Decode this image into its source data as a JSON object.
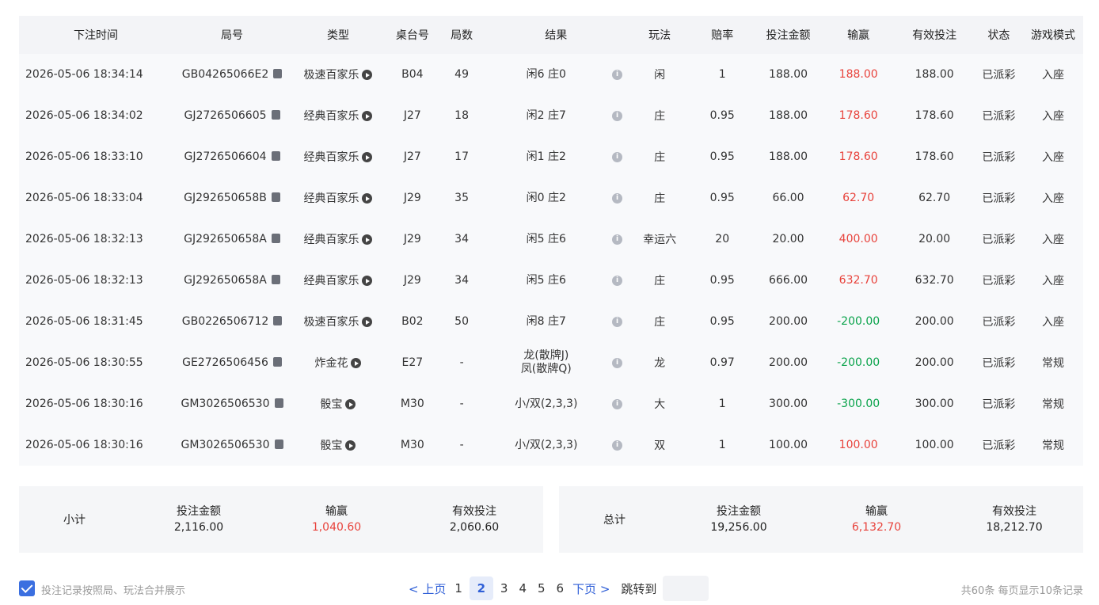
{
  "columns": [
    "下注时间",
    "局号",
    "类型",
    "桌台号",
    "局数",
    "结果",
    "玩法",
    "赔率",
    "投注金额",
    "输赢",
    "有效投注",
    "状态",
    "游戏模式"
  ],
  "rows": [
    {
      "time": "2026-05-06 18:34:14",
      "round": "GB04265066E2",
      "type": "极速百家乐",
      "table": "B04",
      "num": "49",
      "result": "闲6 庄0",
      "play": "闲",
      "odds": "1",
      "bet": "188.00",
      "win": "188.00",
      "win_color": "red",
      "valid": "188.00",
      "status": "已派彩",
      "mode": "入座"
    },
    {
      "time": "2026-05-06 18:34:02",
      "round": "GJ2726506605",
      "type": "经典百家乐",
      "table": "J27",
      "num": "18",
      "result": "闲2 庄7",
      "play": "庄",
      "odds": "0.95",
      "bet": "188.00",
      "win": "178.60",
      "win_color": "red",
      "valid": "178.60",
      "status": "已派彩",
      "mode": "入座"
    },
    {
      "time": "2026-05-06 18:33:10",
      "round": "GJ2726506604",
      "type": "经典百家乐",
      "table": "J27",
      "num": "17",
      "result": "闲1 庄2",
      "play": "庄",
      "odds": "0.95",
      "bet": "188.00",
      "win": "178.60",
      "win_color": "red",
      "valid": "178.60",
      "status": "已派彩",
      "mode": "入座"
    },
    {
      "time": "2026-05-06 18:33:04",
      "round": "GJ292650658B",
      "type": "经典百家乐",
      "table": "J29",
      "num": "35",
      "result": "闲0 庄2",
      "play": "庄",
      "odds": "0.95",
      "bet": "66.00",
      "win": "62.70",
      "win_color": "red",
      "valid": "62.70",
      "status": "已派彩",
      "mode": "入座"
    },
    {
      "time": "2026-05-06 18:32:13",
      "round": "GJ292650658A",
      "type": "经典百家乐",
      "table": "J29",
      "num": "34",
      "result": "闲5 庄6",
      "play": "幸运六",
      "odds": "20",
      "bet": "20.00",
      "win": "400.00",
      "win_color": "red",
      "valid": "20.00",
      "status": "已派彩",
      "mode": "入座"
    },
    {
      "time": "2026-05-06 18:32:13",
      "round": "GJ292650658A",
      "type": "经典百家乐",
      "table": "J29",
      "num": "34",
      "result": "闲5 庄6",
      "play": "庄",
      "odds": "0.95",
      "bet": "666.00",
      "win": "632.70",
      "win_color": "red",
      "valid": "632.70",
      "status": "已派彩",
      "mode": "入座"
    },
    {
      "time": "2026-05-06 18:31:45",
      "round": "GB0226506712",
      "type": "极速百家乐",
      "table": "B02",
      "num": "50",
      "result": "闲8 庄7",
      "play": "庄",
      "odds": "0.95",
      "bet": "200.00",
      "win": "-200.00",
      "win_color": "green",
      "valid": "200.00",
      "status": "已派彩",
      "mode": "入座"
    },
    {
      "time": "2026-05-06 18:30:55",
      "round": "GE2726506456",
      "type": "炸金花",
      "table": "E27",
      "num": "-",
      "result": "龙(散牌J)",
      "result2": "凤(散牌Q)",
      "play": "龙",
      "odds": "0.97",
      "bet": "200.00",
      "win": "-200.00",
      "win_color": "green",
      "valid": "200.00",
      "status": "已派彩",
      "mode": "常规"
    },
    {
      "time": "2026-05-06 18:30:16",
      "round": "GM3026506530",
      "type": "骰宝",
      "table": "M30",
      "num": "-",
      "result": "小/双(2,3,3)",
      "play": "大",
      "odds": "1",
      "bet": "300.00",
      "win": "-300.00",
      "win_color": "green",
      "valid": "300.00",
      "status": "已派彩",
      "mode": "常规"
    },
    {
      "time": "2026-05-06 18:30:16",
      "round": "GM3026506530",
      "type": "骰宝",
      "table": "M30",
      "num": "-",
      "result": "小/双(2,3,3)",
      "play": "双",
      "odds": "1",
      "bet": "100.00",
      "win": "100.00",
      "win_color": "red",
      "valid": "100.00",
      "status": "已派彩",
      "mode": "常规"
    }
  ],
  "subtotal": {
    "title": "小计",
    "bet_label": "投注金额",
    "bet": "2,116.00",
    "win_label": "输赢",
    "win": "1,040.60",
    "valid_label": "有效投注",
    "valid": "2,060.60"
  },
  "total": {
    "title": "总计",
    "bet_label": "投注金额",
    "bet": "19,256.00",
    "win_label": "输赢",
    "win": "6,132.70",
    "valid_label": "有效投注",
    "valid": "18,212.70"
  },
  "footer": {
    "merge_label": "投注记录按照局、玩法合并展示",
    "merge_checked": true,
    "prev": "< 上页",
    "next": "下页 >",
    "pages": [
      "1",
      "2",
      "3",
      "4",
      "5",
      "6"
    ],
    "current_page": "2",
    "jump_label": "跳转到",
    "jump_value": "",
    "summary": "共60条  每页显示10条记录"
  },
  "colors": {
    "win": "#e8423b",
    "loss": "#0aa34b",
    "accent": "#2f5fd7"
  }
}
